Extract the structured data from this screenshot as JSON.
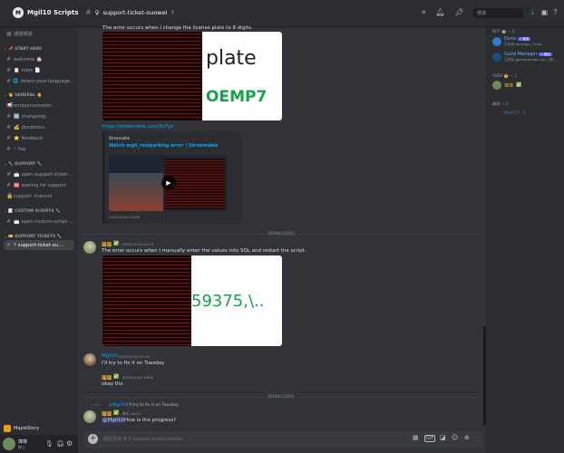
{
  "server": {
    "name": "Mgil10 Scripts",
    "logo_text": "M"
  },
  "channel_header": {
    "name": "support-ticket-ouowei",
    "search_placeholder": "搜尋"
  },
  "sidebar": {
    "top": "運營頻道",
    "categories": {
      "start": "START HERE",
      "general": "GENERAL",
      "support": "SUPPORT",
      "custom": "CUSTOM SCRIPTS",
      "tickets": "SUPPORT TICKETS"
    },
    "items": {
      "welcome": "welcome",
      "rules": "rules",
      "select_lang": "select-your-language...",
      "announcements": "announcements",
      "changelog": "changelog",
      "donations": "donations",
      "feedback": "feedback",
      "faq": "faq",
      "open_support": "open-support-ticket-...",
      "waiting": "waiting for support",
      "support_channel": "support channel",
      "open_custom": "open-custom-script-...",
      "active": "support-ticket-ou..."
    }
  },
  "maple": {
    "label": "MapleStory"
  },
  "user_panel": {
    "name": "瑋瑋",
    "status": "線上"
  },
  "messages": {
    "first_text": "The error occurs when I change the license plate to 8 digits.",
    "img1_word1": "plate",
    "img1_word2": "OEMP7",
    "streamable_link": "https://streamable.com/5v7yk",
    "embed_provider": "Streamable",
    "embed_title": "Watch mgil_realparking error | Streamable",
    "embed_time": "2024/11/03 23:49",
    "divider1": "2024年11月4日",
    "u1_name": "瑋瑋",
    "u1_time": "2024/11/04 00:13",
    "u1_text": "The error occurs when I manually enter the values into SQL and restart the script.",
    "img2_text": "59375,\\..",
    "u2_name": "Mgil10",
    "u2_time": "2024/11/04 07:19",
    "u2_text": "I'll try to fix it on Tuesday",
    "u3_name": "瑋瑋",
    "u3_time": "2024/11/04 19:08",
    "u3_text": "okay thx",
    "divider2": "2024年11月6日",
    "reply_name": "@Mgil10",
    "reply_text": "I'll try to fix it on Tuesday",
    "u4_name": "瑋瑋",
    "u4_time": "昨天 18:32",
    "u4_mention": "@Mgil10",
    "u4_text": "How is the progress?"
  },
  "input": {
    "placeholder": "傳訊息到 # ♀ support-ticket-ouowei"
  },
  "members": {
    "bot_cat": "BOT 🤖 — 2",
    "bot1_name": "Dyno",
    "bot1_status": "正在玩 dyno.gg | !help",
    "bot2_name": "Guild Manager",
    "bot2_status": "正在玩 guildmanager.xyz | 使...",
    "bot_badge": "✓ 應用",
    "user_cat": "USER 👑 — 1",
    "user1": "瑋瑋",
    "offline_cat": "離線 — 1",
    "off1": "Mgil10"
  },
  "colors": {
    "accent": "#5865f2",
    "link": "#00a8fc",
    "user_color": "#f0b232"
  }
}
